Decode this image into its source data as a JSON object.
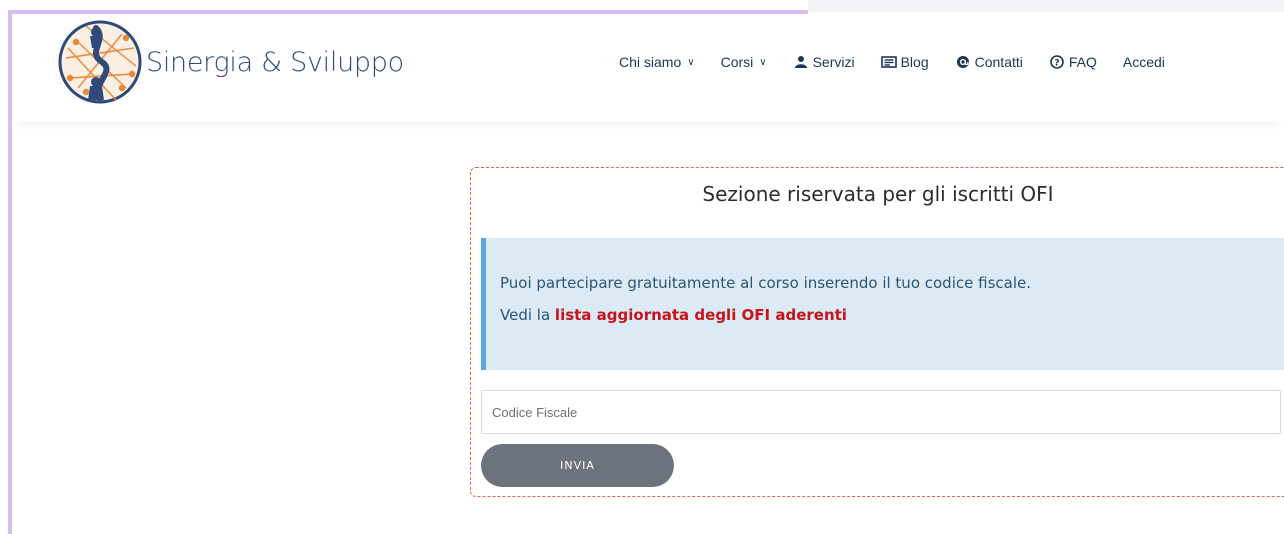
{
  "header": {
    "logo_text": "Sinergia & Sviluppo",
    "nav": [
      {
        "label": "Chi siamo",
        "has_dropdown": true,
        "icon": ""
      },
      {
        "label": "Corsi",
        "has_dropdown": true,
        "icon": ""
      },
      {
        "label": "Servizi",
        "has_dropdown": false,
        "icon": "user-service-icon"
      },
      {
        "label": "Blog",
        "has_dropdown": false,
        "icon": "newspaper-icon"
      },
      {
        "label": "Contatti",
        "has_dropdown": false,
        "icon": "at-sign-icon"
      },
      {
        "label": "FAQ",
        "has_dropdown": false,
        "icon": "question-circle-icon"
      },
      {
        "label": "Accedi",
        "has_dropdown": false,
        "icon": ""
      }
    ]
  },
  "panel": {
    "title": "Sezione riservata per gli iscritti OFI",
    "alert": {
      "line1": "Puoi partecipare gratuitamente al corso inserendo il tuo codice fiscale.",
      "line2_prefix": "Vedi la ",
      "line2_link": "lista aggiornata degli OFI aderenti"
    },
    "input_placeholder": "Codice Fiscale",
    "input_value": "",
    "submit_label": "INVIA"
  },
  "colors": {
    "nav_text": "#1d3557",
    "alert_bg": "#dbeaf5",
    "alert_border": "#5ba6dc",
    "alert_text": "#2d5574",
    "link_red": "#c8131b",
    "button_bg": "#6c737d",
    "panel_border": "#d9694a",
    "window_border": "#d6bff0"
  }
}
